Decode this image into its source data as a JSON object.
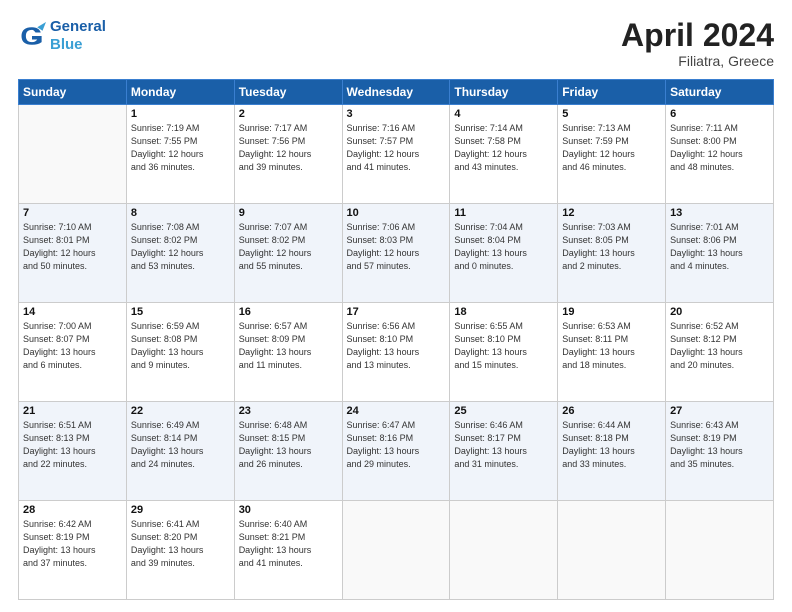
{
  "logo": {
    "line1": "General",
    "line2": "Blue"
  },
  "title": "April 2024",
  "subtitle": "Filiatra, Greece",
  "weekdays": [
    "Sunday",
    "Monday",
    "Tuesday",
    "Wednesday",
    "Thursday",
    "Friday",
    "Saturday"
  ],
  "weeks": [
    [
      {
        "day": "",
        "info": ""
      },
      {
        "day": "1",
        "info": "Sunrise: 7:19 AM\nSunset: 7:55 PM\nDaylight: 12 hours\nand 36 minutes."
      },
      {
        "day": "2",
        "info": "Sunrise: 7:17 AM\nSunset: 7:56 PM\nDaylight: 12 hours\nand 39 minutes."
      },
      {
        "day": "3",
        "info": "Sunrise: 7:16 AM\nSunset: 7:57 PM\nDaylight: 12 hours\nand 41 minutes."
      },
      {
        "day": "4",
        "info": "Sunrise: 7:14 AM\nSunset: 7:58 PM\nDaylight: 12 hours\nand 43 minutes."
      },
      {
        "day": "5",
        "info": "Sunrise: 7:13 AM\nSunset: 7:59 PM\nDaylight: 12 hours\nand 46 minutes."
      },
      {
        "day": "6",
        "info": "Sunrise: 7:11 AM\nSunset: 8:00 PM\nDaylight: 12 hours\nand 48 minutes."
      }
    ],
    [
      {
        "day": "7",
        "info": "Sunrise: 7:10 AM\nSunset: 8:01 PM\nDaylight: 12 hours\nand 50 minutes."
      },
      {
        "day": "8",
        "info": "Sunrise: 7:08 AM\nSunset: 8:02 PM\nDaylight: 12 hours\nand 53 minutes."
      },
      {
        "day": "9",
        "info": "Sunrise: 7:07 AM\nSunset: 8:02 PM\nDaylight: 12 hours\nand 55 minutes."
      },
      {
        "day": "10",
        "info": "Sunrise: 7:06 AM\nSunset: 8:03 PM\nDaylight: 12 hours\nand 57 minutes."
      },
      {
        "day": "11",
        "info": "Sunrise: 7:04 AM\nSunset: 8:04 PM\nDaylight: 13 hours\nand 0 minutes."
      },
      {
        "day": "12",
        "info": "Sunrise: 7:03 AM\nSunset: 8:05 PM\nDaylight: 13 hours\nand 2 minutes."
      },
      {
        "day": "13",
        "info": "Sunrise: 7:01 AM\nSunset: 8:06 PM\nDaylight: 13 hours\nand 4 minutes."
      }
    ],
    [
      {
        "day": "14",
        "info": "Sunrise: 7:00 AM\nSunset: 8:07 PM\nDaylight: 13 hours\nand 6 minutes."
      },
      {
        "day": "15",
        "info": "Sunrise: 6:59 AM\nSunset: 8:08 PM\nDaylight: 13 hours\nand 9 minutes."
      },
      {
        "day": "16",
        "info": "Sunrise: 6:57 AM\nSunset: 8:09 PM\nDaylight: 13 hours\nand 11 minutes."
      },
      {
        "day": "17",
        "info": "Sunrise: 6:56 AM\nSunset: 8:10 PM\nDaylight: 13 hours\nand 13 minutes."
      },
      {
        "day": "18",
        "info": "Sunrise: 6:55 AM\nSunset: 8:10 PM\nDaylight: 13 hours\nand 15 minutes."
      },
      {
        "day": "19",
        "info": "Sunrise: 6:53 AM\nSunset: 8:11 PM\nDaylight: 13 hours\nand 18 minutes."
      },
      {
        "day": "20",
        "info": "Sunrise: 6:52 AM\nSunset: 8:12 PM\nDaylight: 13 hours\nand 20 minutes."
      }
    ],
    [
      {
        "day": "21",
        "info": "Sunrise: 6:51 AM\nSunset: 8:13 PM\nDaylight: 13 hours\nand 22 minutes."
      },
      {
        "day": "22",
        "info": "Sunrise: 6:49 AM\nSunset: 8:14 PM\nDaylight: 13 hours\nand 24 minutes."
      },
      {
        "day": "23",
        "info": "Sunrise: 6:48 AM\nSunset: 8:15 PM\nDaylight: 13 hours\nand 26 minutes."
      },
      {
        "day": "24",
        "info": "Sunrise: 6:47 AM\nSunset: 8:16 PM\nDaylight: 13 hours\nand 29 minutes."
      },
      {
        "day": "25",
        "info": "Sunrise: 6:46 AM\nSunset: 8:17 PM\nDaylight: 13 hours\nand 31 minutes."
      },
      {
        "day": "26",
        "info": "Sunrise: 6:44 AM\nSunset: 8:18 PM\nDaylight: 13 hours\nand 33 minutes."
      },
      {
        "day": "27",
        "info": "Sunrise: 6:43 AM\nSunset: 8:19 PM\nDaylight: 13 hours\nand 35 minutes."
      }
    ],
    [
      {
        "day": "28",
        "info": "Sunrise: 6:42 AM\nSunset: 8:19 PM\nDaylight: 13 hours\nand 37 minutes."
      },
      {
        "day": "29",
        "info": "Sunrise: 6:41 AM\nSunset: 8:20 PM\nDaylight: 13 hours\nand 39 minutes."
      },
      {
        "day": "30",
        "info": "Sunrise: 6:40 AM\nSunset: 8:21 PM\nDaylight: 13 hours\nand 41 minutes."
      },
      {
        "day": "",
        "info": ""
      },
      {
        "day": "",
        "info": ""
      },
      {
        "day": "",
        "info": ""
      },
      {
        "day": "",
        "info": ""
      }
    ]
  ]
}
